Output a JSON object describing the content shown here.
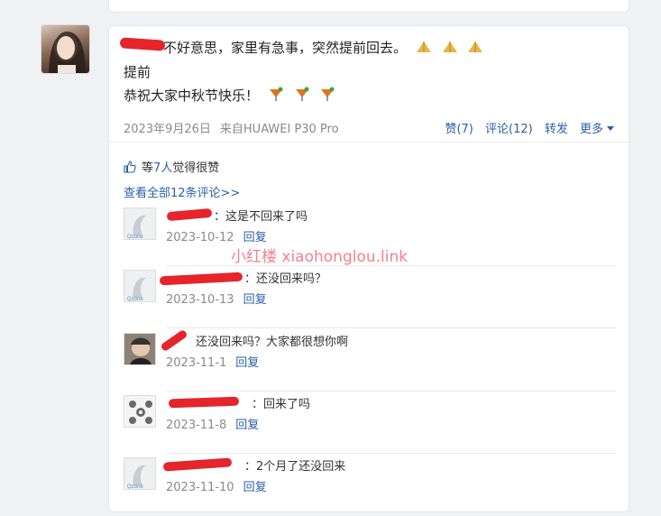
{
  "post": {
    "line1": "不好意思，家里有急事，突然提前回去。",
    "line2": "提前",
    "line3": "恭祝大家中秋节快乐！",
    "line1_emoji": "hands-pressed-icon",
    "line3_emoji": "cocktail-icon",
    "date": "2023年9月26日",
    "source": "来自HUAWEI P30 Pro"
  },
  "actions": {
    "like": "赞(7)",
    "comment": "评论(12)",
    "share": "转发",
    "more": "更多"
  },
  "likes": {
    "prefix": "等",
    "count": "7人",
    "suffix": "觉得很赞"
  },
  "view_all": "查看全部12条评论>>",
  "comments": [
    {
      "text": "：这是不回来了吗",
      "date": "2023-10-12",
      "reply": "回复",
      "avatar": "qzone-default-avatar"
    },
    {
      "text": "：还没回来吗？",
      "date": "2023-10-13",
      "reply": "回复",
      "avatar": "qzone-default-avatar"
    },
    {
      "text": "还没回来吗？大家都很想你啊",
      "date": "2023-11-1",
      "reply": "回复",
      "avatar": "photo-avatar"
    },
    {
      "text": "：回来了吗",
      "date": "2023-11-8",
      "reply": "回复",
      "avatar": "pattern-avatar"
    },
    {
      "text": "：2个月了还没回来",
      "date": "2023-11-10",
      "reply": "回复",
      "avatar": "qzone-default-avatar"
    }
  ],
  "watermark": "小红楼  xiaohonglou.link",
  "colors": {
    "link": "#2a5fa8",
    "redaction": "#e5242b",
    "watermark": "#f03c50"
  }
}
